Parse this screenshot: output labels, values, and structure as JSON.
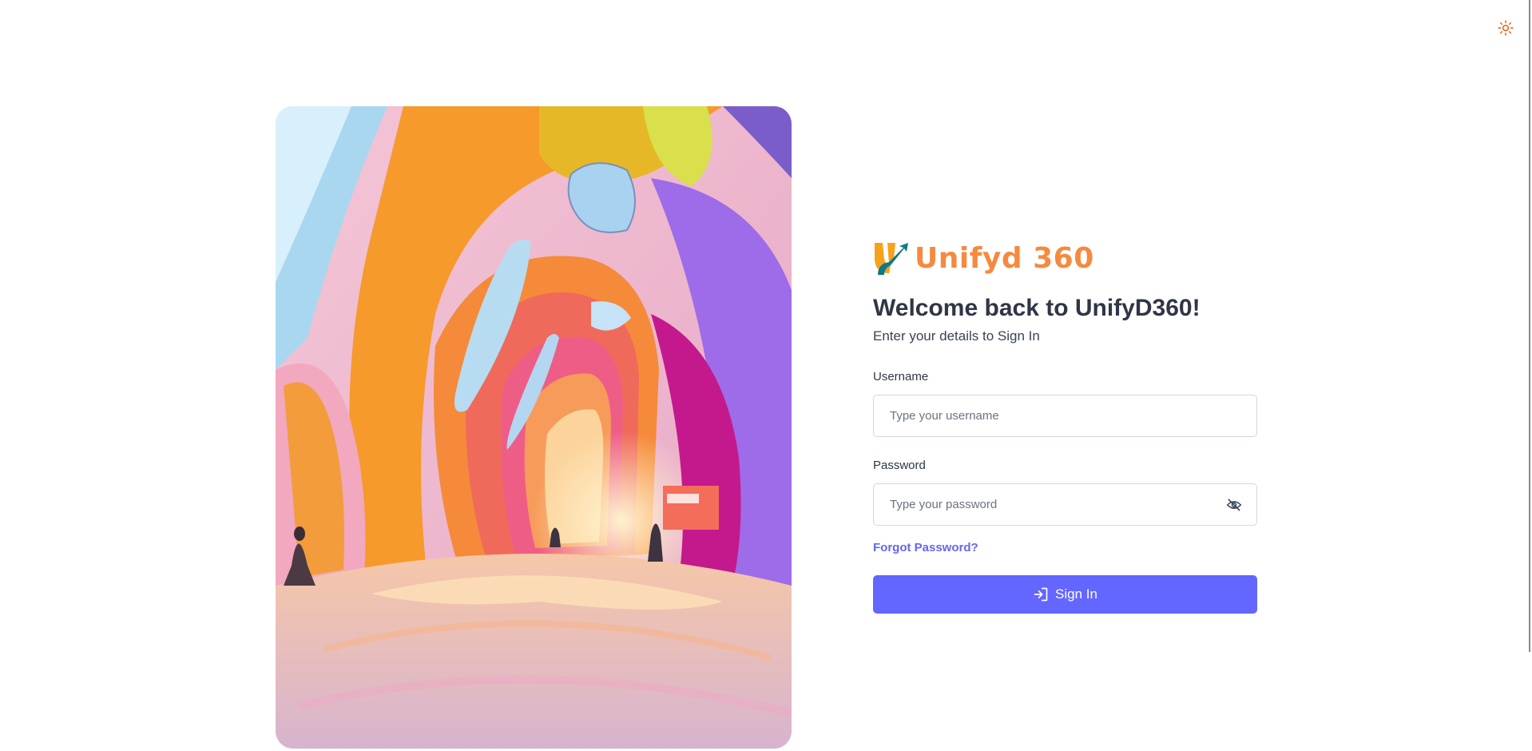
{
  "brand": {
    "name": "Unifyd 360",
    "logo_icon": "unifyd-logo-icon",
    "color": "#f58a3f"
  },
  "header": {
    "theme_toggle_icon": "sun-icon"
  },
  "login": {
    "title": "Welcome back to UnifyD360!",
    "subtitle": "Enter your details to Sign In",
    "username": {
      "label": "Username",
      "placeholder": "Type your username",
      "value": ""
    },
    "password": {
      "label": "Password",
      "placeholder": "Type your password",
      "value": "",
      "toggle_icon": "eye-slash-icon"
    },
    "forgot_password": "Forgot Password?",
    "submit": {
      "label": "Sign In",
      "icon": "sign-in-icon",
      "color": "#6366ff"
    }
  },
  "hero": {
    "image_icon": "colorful-arched-corridor-image"
  }
}
